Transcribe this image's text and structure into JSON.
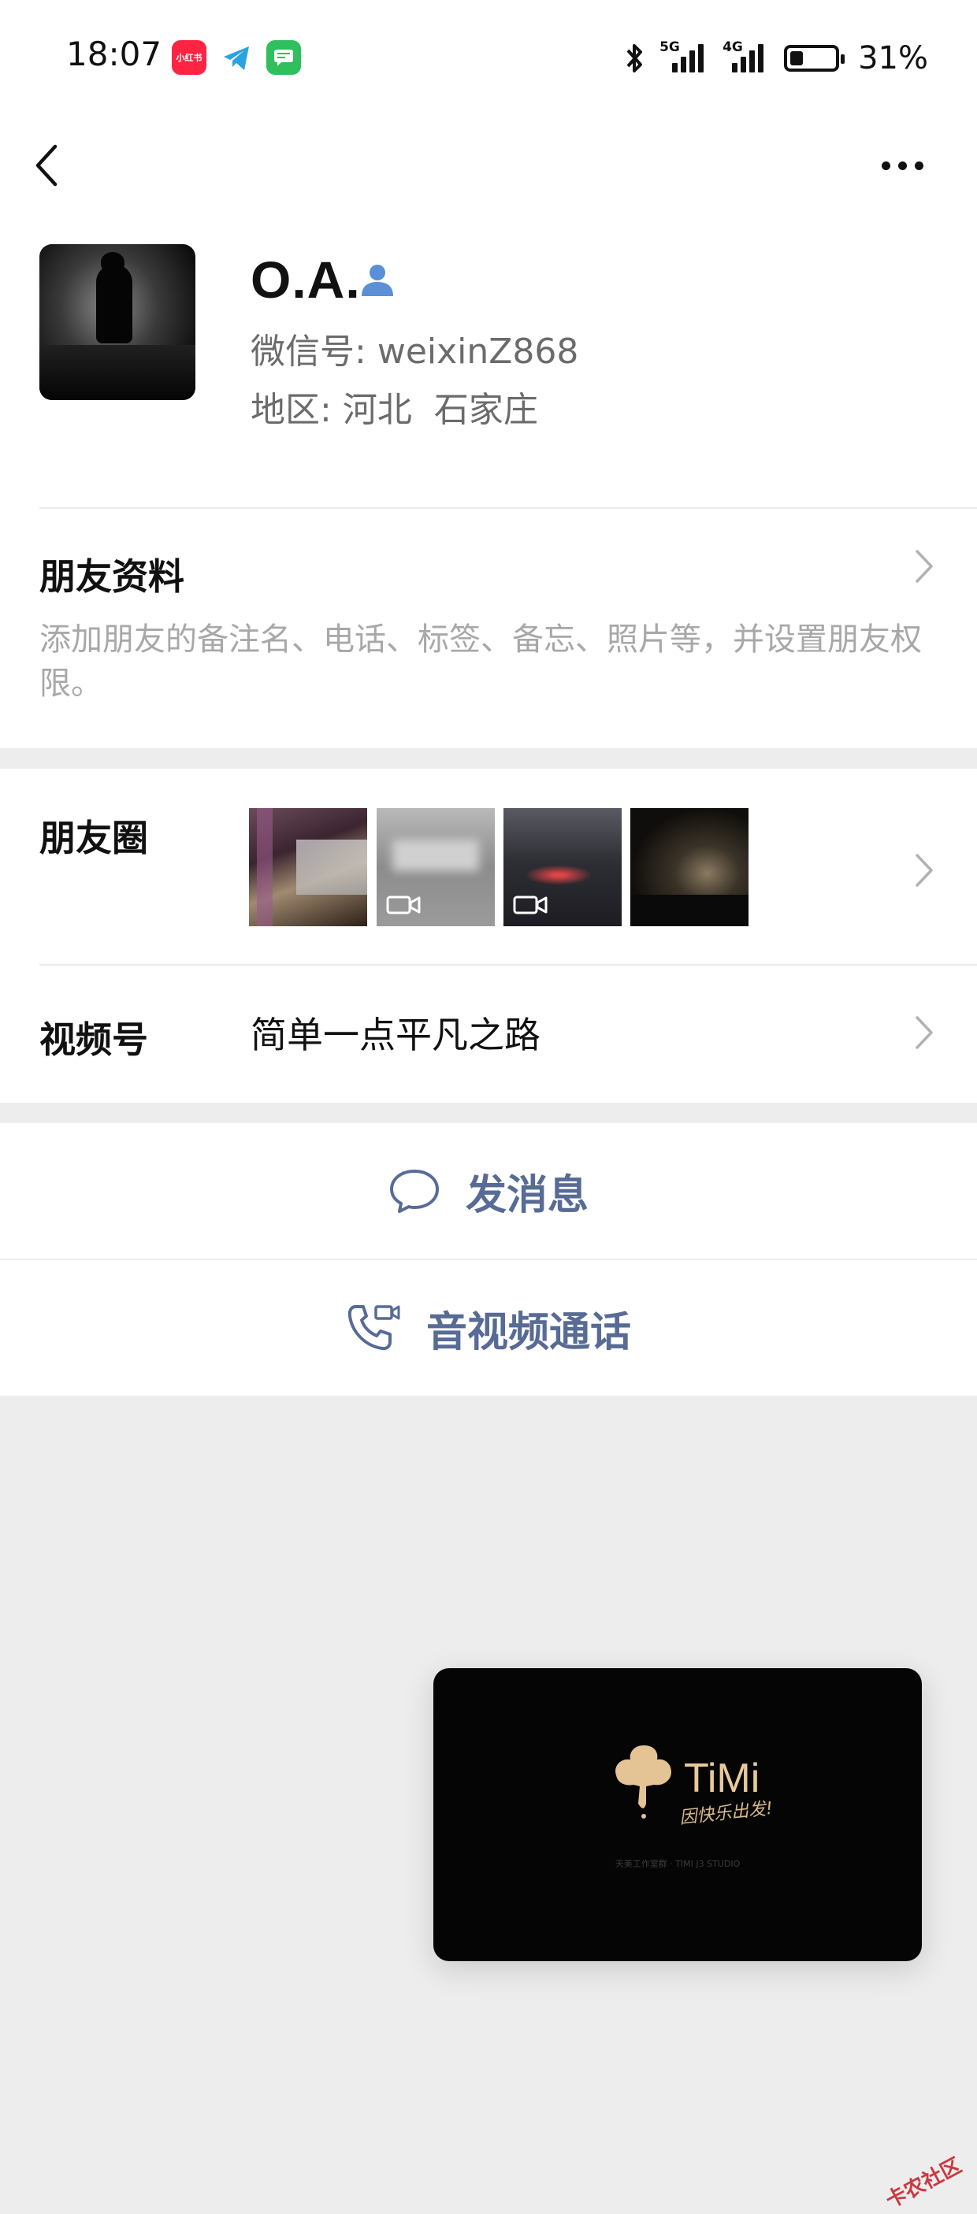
{
  "status_bar": {
    "time": "18:07",
    "app_icons": [
      {
        "name": "xiaohongshu-icon",
        "label": "小红书",
        "color": "#ff2442"
      },
      {
        "name": "telegram-icon",
        "label": "",
        "color": "#2aa3e0"
      },
      {
        "name": "messages-icon",
        "label": "",
        "color": "#2fbf5c"
      }
    ],
    "network_5g": "5G",
    "network_4g": "4G",
    "battery": "31%"
  },
  "profile": {
    "name": "O.A.",
    "wechat_id_label": "微信号:",
    "wechat_id": "weixinZ868",
    "region_label": "地区:",
    "region_province": "河北",
    "region_city": "石家庄"
  },
  "friend_info": {
    "title": "朋友资料",
    "description": "添加朋友的备注名、电话、标签、备忘、照片等，并设置朋友权限。"
  },
  "moments": {
    "label": "朋友圈",
    "thumbnails": [
      {
        "name": "moment-photo-1",
        "is_video": false
      },
      {
        "name": "moment-photo-2",
        "is_video": true
      },
      {
        "name": "moment-photo-3",
        "is_video": true
      },
      {
        "name": "moment-photo-4",
        "is_video": false
      }
    ]
  },
  "channels": {
    "label": "视频号",
    "channel_name": "简单一点平凡之路"
  },
  "actions": {
    "send_message": "发消息",
    "av_call": "音视频通话"
  },
  "pip": {
    "logo_text": "TiMi",
    "slogan": "因快乐出发!",
    "studio_line": "天美工作室群 · TIMI J3 STUDIO"
  },
  "watermark": "卡农社区",
  "colors": {
    "link_blue": "#576b95",
    "contact_icon_blue": "#5b8fd6",
    "page_bg": "#ededed"
  }
}
